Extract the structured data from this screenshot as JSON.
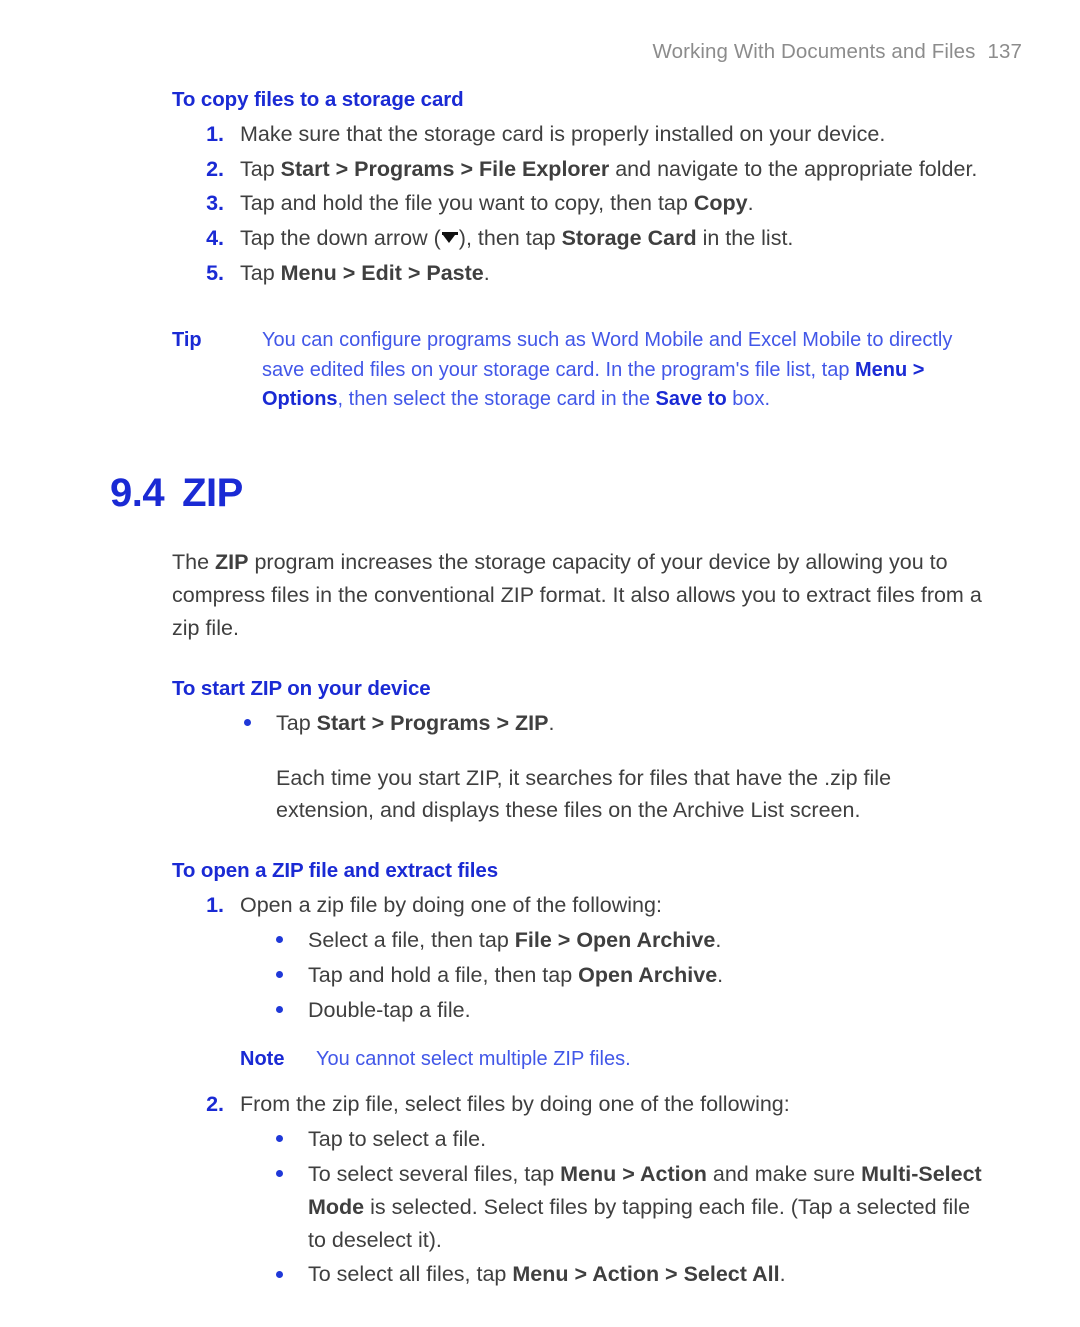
{
  "header": {
    "chapter_title": "Working With Documents and Files",
    "page_number": "137"
  },
  "sections": {
    "copy_files": {
      "heading": "To copy files to a storage card",
      "steps": [
        {
          "num": "1.",
          "text_html": "Make sure that the storage card is properly installed on your device."
        },
        {
          "num": "2.",
          "text_html": "Tap <b>Start &gt; Programs &gt; File Explorer</b> and navigate to the appropriate folder."
        },
        {
          "num": "3.",
          "text_html": "Tap and hold the file you want to copy, then tap <b>Copy</b>."
        },
        {
          "num": "4.",
          "text_html": "Tap the down arrow (<span class=\"downarrow\" data-name=\"down-arrow-icon\" data-interactable=\"false\"></span>), then tap <b>Storage Card</b> in the list."
        },
        {
          "num": "5.",
          "text_html": "Tap <b>Menu &gt; Edit &gt; Paste</b>."
        }
      ],
      "tip": {
        "label": "Tip",
        "text_html": "You can configure programs such as Word Mobile and Excel Mobile to directly save edited files on your storage card. In the program's file list, tap <b>Menu &gt; Options</b>, then select the storage card in the <b>Save to</b> box."
      }
    },
    "zip": {
      "number": "9.4",
      "title": "ZIP",
      "intro_html": "The <b>ZIP</b> program increases the storage capacity of your device by allowing you to compress files in the conventional ZIP format. It also allows you to extract files from a zip file.",
      "start_zip": {
        "heading": "To start ZIP on your device",
        "bullets": [
          {
            "text_html": "Tap <b>Start &gt; Programs &gt; ZIP</b>."
          }
        ],
        "follow_paragraph": "Each time you start ZIP, it searches for files that have the .zip file extension, and displays these files on the Archive List screen."
      },
      "open_zip": {
        "heading": "To open a ZIP file and extract files",
        "step1": {
          "num": "1.",
          "text_html": "Open a zip file by doing one of the following:",
          "bullets": [
            {
              "text_html": "Select a file, then tap <b>File &gt; Open Archive</b>."
            },
            {
              "text_html": "Tap and hold a file, then tap <b>Open Archive</b>."
            },
            {
              "text_html": "Double-tap a file."
            }
          ],
          "note": {
            "label": "Note",
            "text_html": "You cannot select multiple ZIP files."
          }
        },
        "step2": {
          "num": "2.",
          "text_html": "From the zip file, select files by doing one of the following:",
          "bullets": [
            {
              "text_html": "Tap to select a file."
            },
            {
              "text_html": "To select several files, tap <b>Menu &gt; Action</b> and make sure <b>Multi-Select Mode</b> is selected. Select files by tapping each file. (Tap a selected file to deselect it)."
            },
            {
              "text_html": "To select all files, tap <b>Menu &gt; Action &gt; Select All</b>."
            }
          ]
        }
      }
    }
  },
  "colors": {
    "heading_blue": "#1a2ad4",
    "callout_blue": "#4257e8",
    "body_gray": "#3f3f3f",
    "header_gray": "#8c8c8c"
  }
}
